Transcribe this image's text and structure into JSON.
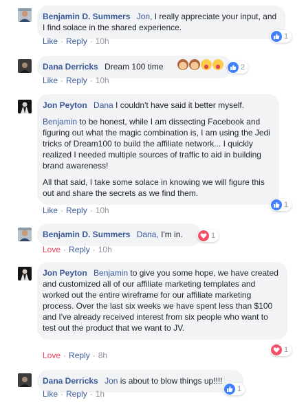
{
  "comments": [
    {
      "author": "Benjamin D. Summers",
      "tag": "Jon,",
      "text": " I really appreciate your input, and I find solace in the shared experience.",
      "reaction": {
        "type": "like",
        "count": "1"
      },
      "actions": {
        "react": "Like",
        "reply": "Reply",
        "time": "10h"
      }
    },
    {
      "author": "Dana Derricks",
      "tag": "",
      "text": "Dream 100 time",
      "reaction": {
        "type": "like",
        "count": "2"
      },
      "actions": {
        "react": "Like",
        "reply": "Reply",
        "time": "10h"
      }
    },
    {
      "author": "Jon Peyton",
      "tag": "Dana",
      "text": " I couldn't have said it better myself.",
      "p2_tag": "Benjamin",
      "p2_text": " to be honest, while I am dissecting Facebook and figuring out what the magic combination is, I am using the Jedi tricks of Dream100 to build the affiliate network... I quickly realized I needed multiple sources of traffic to aid in building brand awareness!",
      "p3_text": "All that said, I take some solace in knowing we will figure this out and share the secrets as we find them.",
      "reaction": {
        "type": "like",
        "count": "1"
      },
      "actions": {
        "react": "Like",
        "reply": "Reply",
        "time": "10h"
      }
    },
    {
      "author": "Benjamin D. Summers",
      "tag": "Dana,",
      "text": " I'm in.",
      "reaction": {
        "type": "love",
        "count": "1"
      },
      "actions": {
        "react": "Love",
        "reply": "Reply",
        "time": "10h"
      }
    },
    {
      "author": "Jon Peyton",
      "tag": "Benjamin",
      "text": " to give you some hope, we have created and customized all of our affiliate marketing templates and worked out the entire wireframe for our affiliate marketing process. Over the last six weeks we have spent less than $100 and I've already received interest from six people who want to test out the product that we want to JV.",
      "reaction": {
        "type": "love",
        "count": "1"
      },
      "actions": {
        "react": "Love",
        "reply": "Reply",
        "time": "8h"
      }
    },
    {
      "author": "Dana Derricks",
      "tag": "Jon",
      "text": " is about to blow things up!!!!",
      "reaction": {
        "type": "like",
        "count": "1"
      },
      "actions": {
        "react": "Like",
        "reply": "Reply",
        "time": "1h"
      }
    }
  ],
  "colors": {
    "link": "#385898",
    "bubble": "#f2f3f5",
    "meta": "#90949c",
    "like": "#4080ff",
    "love": "#f33e58"
  }
}
